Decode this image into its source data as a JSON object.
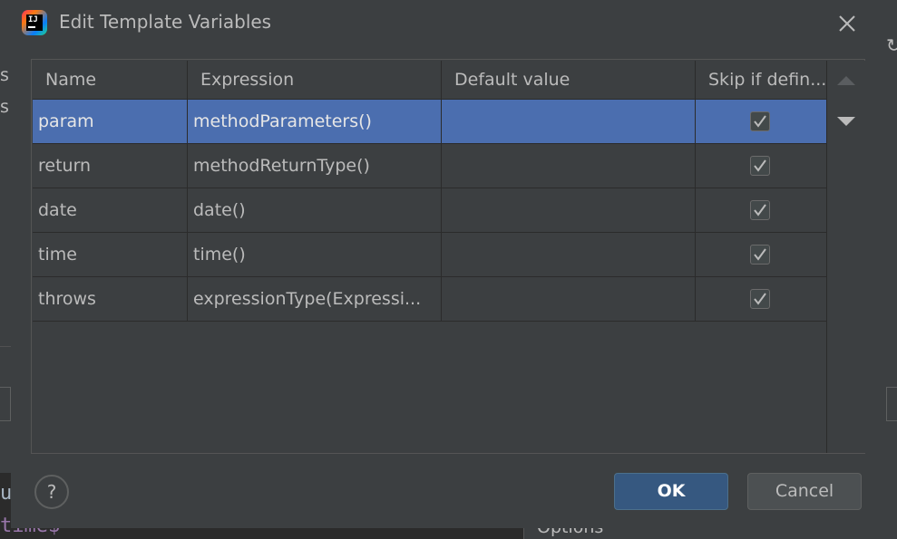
{
  "background": {
    "left_fragments": [
      "s",
      "s"
    ],
    "code_fragment_a": "ur",
    "code_fragment_b": "time$",
    "right_fragment": "↻",
    "options_fragment": "Options"
  },
  "dialog": {
    "title": "Edit Template Variables",
    "icons": {
      "app": "intellij-logo-icon",
      "close": "close-icon",
      "move_up": "arrow-up-icon",
      "move_down": "arrow-down-icon",
      "help": "help-icon"
    }
  },
  "table": {
    "columns": [
      "Name",
      "Expression",
      "Default value",
      "Skip if defin..."
    ],
    "rows": [
      {
        "name": "param",
        "expression": "methodParameters()",
        "default_value": "",
        "skip_if_defined": true,
        "selected": true
      },
      {
        "name": "return",
        "expression": "methodReturnType()",
        "default_value": "",
        "skip_if_defined": true,
        "selected": false
      },
      {
        "name": "date",
        "expression": "date()",
        "default_value": "",
        "skip_if_defined": true,
        "selected": false
      },
      {
        "name": "time",
        "expression": "time()",
        "default_value": "",
        "skip_if_defined": true,
        "selected": false
      },
      {
        "name": "throws",
        "expression": "expressionType(Expressi...",
        "default_value": "",
        "skip_if_defined": true,
        "selected": false
      }
    ]
  },
  "buttons": {
    "help_label": "?",
    "ok_label": "OK",
    "cancel_label": "Cancel"
  },
  "colors": {
    "dialog_bg": "#3c3f41",
    "selection": "#4b6eaf",
    "ok_button": "#365880",
    "text": "#bbbbbb"
  }
}
